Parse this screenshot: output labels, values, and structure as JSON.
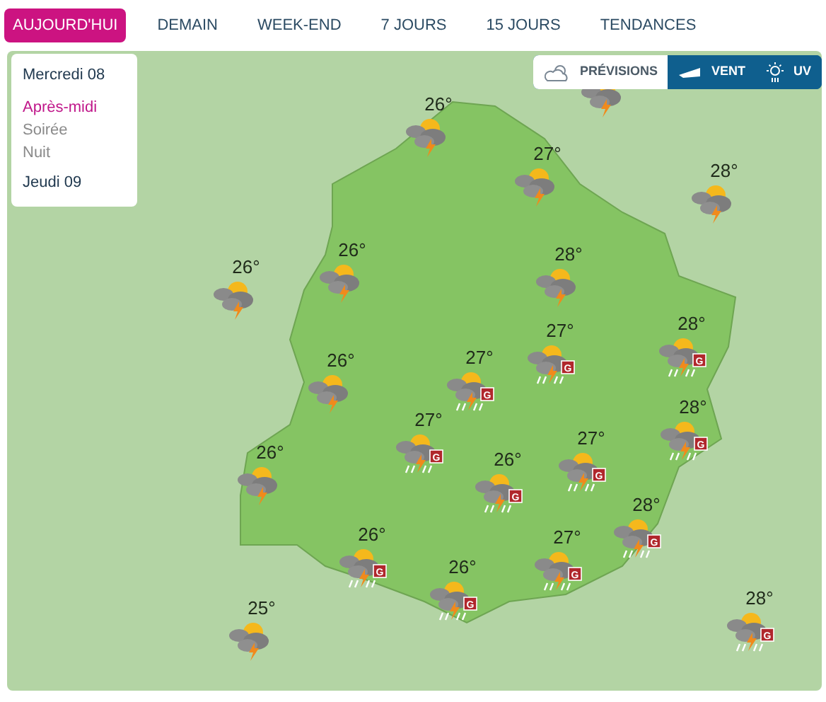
{
  "tabs": [
    {
      "label": "AUJOURD'HUI",
      "selected": true
    },
    {
      "label": "DEMAIN",
      "selected": false
    },
    {
      "label": "WEEK-END",
      "selected": false
    },
    {
      "label": "7 JOURS",
      "selected": false
    },
    {
      "label": "15 JOURS",
      "selected": false
    },
    {
      "label": "TENDANCES",
      "selected": false
    }
  ],
  "periods": [
    {
      "kind": "day",
      "label": "Mercredi 08"
    },
    {
      "kind": "period",
      "label": "Après-midi",
      "selected": true
    },
    {
      "kind": "period",
      "label": "Soirée",
      "selected": false
    },
    {
      "kind": "period",
      "label": "Nuit",
      "selected": false
    },
    {
      "kind": "day",
      "label": "Jeudi 09"
    }
  ],
  "layers": [
    {
      "kind": "forecast",
      "label": "PRÉVISIONS",
      "selected": true
    },
    {
      "kind": "wind",
      "label": "VENT",
      "selected": false
    },
    {
      "kind": "uv",
      "label": "UV",
      "selected": false
    }
  ],
  "markers": [
    {
      "temp": "26°",
      "kind": "storm"
    },
    {
      "kind": "storm"
    },
    {
      "temp": "27°",
      "kind": "storm"
    },
    {
      "temp": "28°",
      "kind": "storm"
    },
    {
      "temp": "26°",
      "kind": "storm"
    },
    {
      "temp": "26°",
      "kind": "storm"
    },
    {
      "temp": "28°",
      "kind": "storm"
    },
    {
      "temp": "26°",
      "kind": "storm"
    },
    {
      "temp": "27°",
      "kind": "hail",
      "badge": "G"
    },
    {
      "temp": "27°",
      "kind": "hail",
      "badge": "G"
    },
    {
      "temp": "28°",
      "kind": "hail",
      "badge": "G"
    },
    {
      "temp": "27°",
      "kind": "hail",
      "badge": "G"
    },
    {
      "temp": "28°",
      "kind": "hail",
      "badge": "G"
    },
    {
      "temp": "26°",
      "kind": "storm"
    },
    {
      "temp": "26°",
      "kind": "hail",
      "badge": "G"
    },
    {
      "temp": "27°",
      "kind": "hail",
      "badge": "G"
    },
    {
      "temp": "28°",
      "kind": "hail",
      "badge": "G"
    },
    {
      "temp": "26°",
      "kind": "hail",
      "badge": "G"
    },
    {
      "temp": "27°",
      "kind": "hail",
      "badge": "G"
    },
    {
      "temp": "26°",
      "kind": "hail",
      "badge": "G"
    },
    {
      "temp": "25°",
      "kind": "storm"
    },
    {
      "temp": "28°",
      "kind": "hail",
      "badge": "G"
    }
  ]
}
